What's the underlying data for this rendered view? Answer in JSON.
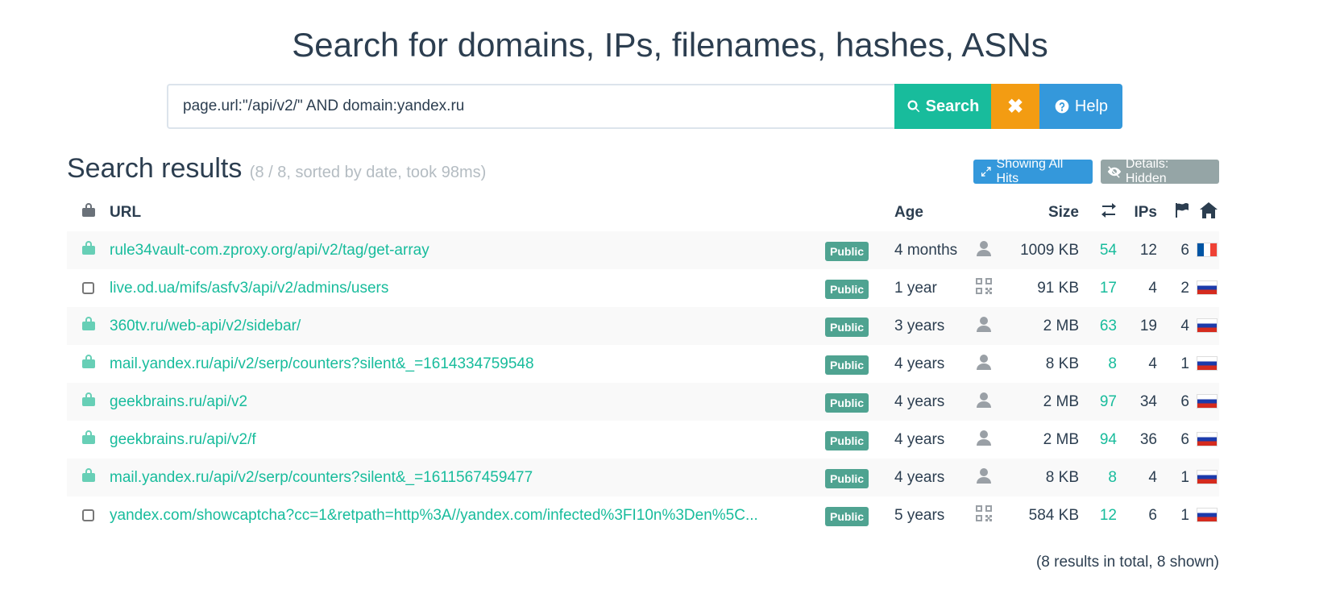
{
  "page_title": "Search for domains, IPs, filenames, hashes, ASNs",
  "search": {
    "query": "page.url:\"/api/v2/\" AND domain:yandex.ru",
    "search_label": "Search",
    "clear_label": "✖",
    "help_label": "Help"
  },
  "results": {
    "title": "Search results",
    "meta": "(8 / 8, sorted by date, took 98ms)",
    "showing_all_hits_label": "Showing All Hits",
    "details_label": "Details: Hidden"
  },
  "table": {
    "headers": {
      "url": "URL",
      "age": "Age",
      "size": "Size",
      "ips": "IPs"
    },
    "rows": [
      {
        "locked": true,
        "url": "rule34vault-com.zproxy.org/api/v2/tag/get-array",
        "visibility": "Public",
        "age": "4 months",
        "source": "user",
        "size": "1009 KB",
        "links": "54",
        "ips": "12",
        "countries": "6",
        "flag": "fr"
      },
      {
        "locked": false,
        "url": "live.od.ua/mifs/asfv3/api/v2/admins/users",
        "visibility": "Public",
        "age": "1 year",
        "source": "qr",
        "size": "91 KB",
        "links": "17",
        "ips": "4",
        "countries": "2",
        "flag": "ru"
      },
      {
        "locked": true,
        "url": "360tv.ru/web-api/v2/sidebar/",
        "visibility": "Public",
        "age": "3 years",
        "source": "user",
        "size": "2 MB",
        "links": "63",
        "ips": "19",
        "countries": "4",
        "flag": "ru"
      },
      {
        "locked": true,
        "url": "mail.yandex.ru/api/v2/serp/counters?silent&_=1614334759548",
        "visibility": "Public",
        "age": "4 years",
        "source": "user",
        "size": "8 KB",
        "links": "8",
        "ips": "4",
        "countries": "1",
        "flag": "ru"
      },
      {
        "locked": true,
        "url": "geekbrains.ru/api/v2",
        "visibility": "Public",
        "age": "4 years",
        "source": "user",
        "size": "2 MB",
        "links": "97",
        "ips": "34",
        "countries": "6",
        "flag": "ru"
      },
      {
        "locked": true,
        "url": "geekbrains.ru/api/v2/f",
        "visibility": "Public",
        "age": "4 years",
        "source": "user",
        "size": "2 MB",
        "links": "94",
        "ips": "36",
        "countries": "6",
        "flag": "ru"
      },
      {
        "locked": true,
        "url": "mail.yandex.ru/api/v2/serp/counters?silent&_=1611567459477",
        "visibility": "Public",
        "age": "4 years",
        "source": "user",
        "size": "8 KB",
        "links": "8",
        "ips": "4",
        "countries": "1",
        "flag": "ru"
      },
      {
        "locked": false,
        "url": "yandex.com/showcaptcha?cc=1&retpath=http%3A//yandex.com/infected%3FI10n%3Den%5C...",
        "visibility": "Public",
        "age": "5 years",
        "source": "qr",
        "size": "584 KB",
        "links": "12",
        "ips": "6",
        "countries": "1",
        "flag": "ru"
      }
    ]
  },
  "footer_note": "(8 results in total, 8 shown)"
}
